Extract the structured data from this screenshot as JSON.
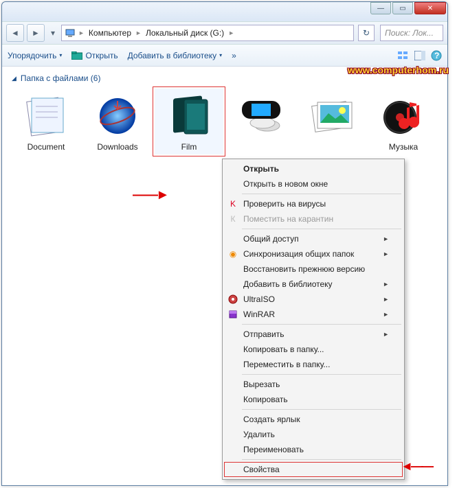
{
  "titlebar": {
    "min": "—",
    "max": "▭",
    "close": "✕"
  },
  "nav": {
    "back": "◄",
    "fwd": "►",
    "drop": "▾",
    "crumbs": [
      "Компьютер",
      "Локальный диск (G:)"
    ],
    "sep": "►",
    "refresh": "↻",
    "search_placeholder": "Поиск: Лок..."
  },
  "toolbar": {
    "organize": "Упорядочить",
    "open": "Открыть",
    "addlib": "Добавить в библиотеку",
    "more": "»",
    "drop": "▾"
  },
  "group": {
    "header": "Папка с файлами (6)",
    "tri": "◢"
  },
  "items": [
    {
      "label": "Document"
    },
    {
      "label": "Downloads"
    },
    {
      "label": "Film"
    },
    {
      "label": ""
    },
    {
      "label": ""
    },
    {
      "label": "Музыка"
    }
  ],
  "context": {
    "open": "Открыть",
    "open_new": "Открыть в новом окне",
    "scan": "Проверить на вирусы",
    "quarantine": "Поместить на карантин",
    "share": "Общий доступ",
    "sync": "Синхронизация общих папок",
    "restore": "Восстановить прежнюю версию",
    "addlib": "Добавить в библиотеку",
    "ultraiso": "UltraISO",
    "winrar": "WinRAR",
    "send": "Отправить",
    "copyto": "Копировать в папку...",
    "moveto": "Переместить в папку...",
    "cut": "Вырезать",
    "copy": "Копировать",
    "shortcut": "Создать ярлык",
    "delete": "Удалить",
    "rename": "Переименовать",
    "props": "Свойства",
    "sub": "►"
  },
  "watermark": "www.computerhom.ru"
}
